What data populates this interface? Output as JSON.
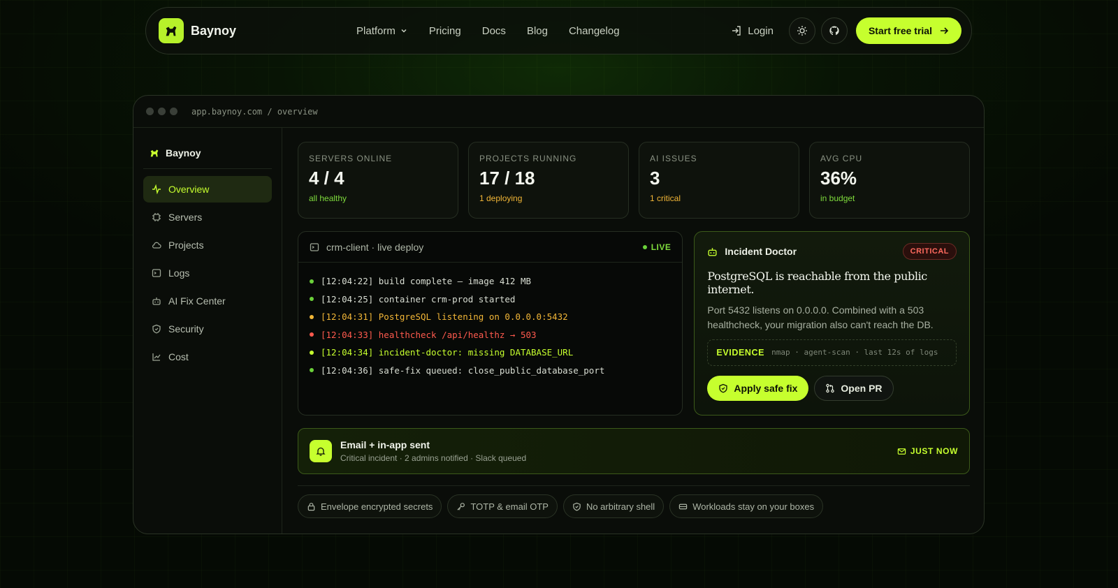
{
  "nav": {
    "brand": "Baynoy",
    "links": [
      "Platform",
      "Pricing",
      "Docs",
      "Blog",
      "Changelog"
    ],
    "login": "Login",
    "cta": "Start free trial"
  },
  "window": {
    "url": "app.baynoy.com / overview"
  },
  "sidebar": {
    "brand": "Baynoy",
    "items": [
      {
        "label": "Overview",
        "icon": "activity-icon"
      },
      {
        "label": "Servers",
        "icon": "chip-icon"
      },
      {
        "label": "Projects",
        "icon": "cloud-icon"
      },
      {
        "label": "Logs",
        "icon": "terminal-icon"
      },
      {
        "label": "AI Fix Center",
        "icon": "bot-icon"
      },
      {
        "label": "Security",
        "icon": "shield-icon"
      },
      {
        "label": "Cost",
        "icon": "chart-icon"
      }
    ]
  },
  "stats": [
    {
      "label": "SERVERS ONLINE",
      "value": "4 / 4",
      "sub": "all healthy",
      "sub_color": "#7fdc3c"
    },
    {
      "label": "PROJECTS RUNNING",
      "value": "17 / 18",
      "sub": "1 deploying",
      "sub_color": "#f2b637"
    },
    {
      "label": "AI ISSUES",
      "value": "3",
      "sub": "1 critical",
      "sub_color": "#f2b637"
    },
    {
      "label": "AVG CPU",
      "value": "36%",
      "sub": "in budget",
      "sub_color": "#7fdc3c"
    }
  ],
  "log": {
    "title": "crm-client · live deploy",
    "status": "LIVE",
    "lines": [
      {
        "text": "[12:04:22] build complete — image 412 MB",
        "color": "#d9ded3",
        "dot": "#6bd13a"
      },
      {
        "text": "[12:04:25] container crm-prod started",
        "color": "#d9ded3",
        "dot": "#6bd13a"
      },
      {
        "text": "[12:04:31] PostgreSQL listening on 0.0.0.0:5432",
        "color": "#f2b637",
        "dot": "#f2b637"
      },
      {
        "text": "[12:04:33] healthcheck /api/healthz → 503",
        "color": "#ff5a4e",
        "dot": "#ff5a4e"
      },
      {
        "text": "[12:04:34] incident-doctor: missing DATABASE_URL",
        "color": "#c6ff2e",
        "dot": "#c6ff2e"
      },
      {
        "text": "[12:04:36] safe-fix queued: close_public_database_port",
        "color": "#d9ded3",
        "dot": "#6bd13a"
      }
    ]
  },
  "incident": {
    "title": "Incident Doctor",
    "badge": "CRITICAL",
    "headline": "PostgreSQL is reachable from the public internet.",
    "body": "Port 5432 listens on 0.0.0.0. Combined with a 503 healthcheck, your migration also can't reach the DB.",
    "evidence_label": "EVIDENCE",
    "evidence_text": "nmap · agent-scan · last 12s of logs",
    "apply_label": "Apply safe fix",
    "pr_label": "Open PR"
  },
  "notification": {
    "title": "Email + in-app sent",
    "subtitle": "Critical incident · 2 admins notified · Slack queued",
    "time": "JUST NOW"
  },
  "chips": [
    {
      "label": "Envelope encrypted secrets",
      "icon": "lock-icon"
    },
    {
      "label": "TOTP & email OTP",
      "icon": "key-icon"
    },
    {
      "label": "No arbitrary shell",
      "icon": "shield-icon"
    },
    {
      "label": "Workloads stay on your boxes",
      "icon": "server-icon"
    }
  ],
  "colors": {
    "accent": "#c6ff2e",
    "critical": "#ff5a4e",
    "warning": "#f2b637",
    "success": "#7fdc3c"
  }
}
